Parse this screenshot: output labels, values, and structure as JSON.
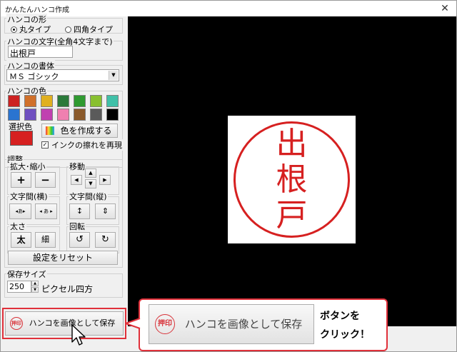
{
  "window": {
    "title": "かんたんハンコ作成",
    "close_glyph": "✕"
  },
  "shape": {
    "legend": "ハンコの形",
    "round_label": "丸タイプ",
    "square_label": "四角タイプ",
    "selected": "round"
  },
  "text": {
    "legend": "ハンコの文字(全角4文字まで)",
    "value": "出根戸"
  },
  "font": {
    "legend": "ハンコの書体",
    "selected": "ＭＳ ゴシック"
  },
  "color": {
    "legend": "ハンコの色",
    "swatches": [
      "#cc2222",
      "#d0702a",
      "#e0b020",
      "#2a7a3a",
      "#2f9a30",
      "#88c030",
      "#40c0a8",
      "#2a74d0",
      "#7050c0",
      "#c040b0",
      "#ef80b0",
      "#8b5a2b",
      "#5a5a5a",
      "#000000"
    ],
    "selected_label": "選択色",
    "selected_color": "#d62020",
    "create_button": "色を作成する",
    "ink_label": "インクの擦れを再現",
    "ink_checked": true
  },
  "adjust": {
    "legend": "調整",
    "scale": {
      "legend": "拡大･縮小",
      "plus": "+",
      "minus": "−"
    },
    "move": {
      "legend": "移動"
    },
    "spacing_h": {
      "legend": "文字間(横)"
    },
    "spacing_v": {
      "legend": "文字間(縦)"
    },
    "weight": {
      "legend": "太さ",
      "bold": "太",
      "thin": "細"
    },
    "rotate": {
      "legend": "回転"
    },
    "reset_button": "設定をリセット"
  },
  "save_size": {
    "legend": "保存サイズ",
    "value": "250",
    "unit": "ピクセル四方"
  },
  "save_button": {
    "label": "ハンコを画像として保存",
    "icon_text": "押印"
  },
  "stamp": {
    "chars": [
      "出",
      "根",
      "戸"
    ],
    "color": "#d62020"
  },
  "callout": {
    "button_label": "ハンコを画像として保存",
    "note_line1": "ボタンを",
    "note_line2": "クリック！",
    "accent": "#e0303a"
  }
}
